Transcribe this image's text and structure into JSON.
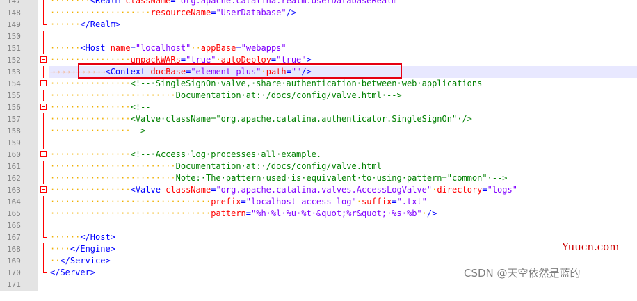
{
  "lines": [
    {
      "n": "147",
      "indent": "········",
      "tokens": [
        [
          "tag",
          "<Realm "
        ],
        [
          "attr",
          "className"
        ],
        [
          "tag",
          "="
        ],
        [
          "val",
          "\"org.apache.catalina.realm.UserDatabaseRealm\""
        ]
      ],
      "fold": "line"
    },
    {
      "n": "148",
      "indent": "····················",
      "tokens": [
        [
          "attr",
          "resourceName"
        ],
        [
          "tag",
          "="
        ],
        [
          "val",
          "\"UserDatabase\""
        ],
        [
          "tag",
          "/>"
        ]
      ],
      "fold": "line"
    },
    {
      "n": "149",
      "indent": "······",
      "tokens": [
        [
          "tag",
          "</Realm>"
        ]
      ],
      "fold": "end"
    },
    {
      "n": "150",
      "indent": "",
      "tokens": [],
      "fold": "line"
    },
    {
      "n": "151",
      "indent": "······",
      "tokens": [
        [
          "tag",
          "<Host "
        ],
        [
          "attr",
          "name"
        ],
        [
          "tag",
          "="
        ],
        [
          "val",
          "\"localhost\""
        ],
        [
          "ws",
          "··"
        ],
        [
          "attr",
          "appBase"
        ],
        [
          "tag",
          "="
        ],
        [
          "val",
          "\"webapps\""
        ]
      ],
      "fold": "line"
    },
    {
      "n": "152",
      "indent": "················",
      "tokens": [
        [
          "attr",
          "unpackWARs"
        ],
        [
          "tag",
          "="
        ],
        [
          "val",
          "\"true\""
        ],
        [
          "ws",
          "·"
        ],
        [
          "attr",
          "autoDeploy"
        ],
        [
          "tag",
          "="
        ],
        [
          "val",
          "\"true\""
        ],
        [
          "tag",
          ">"
        ]
      ],
      "fold": "box"
    },
    {
      "n": "153",
      "indent": "→→→→→→→→→→→",
      "tokens": [
        [
          "tag",
          "<Context "
        ],
        [
          "attr",
          "docBase"
        ],
        [
          "tag",
          "="
        ],
        [
          "val",
          "\"element-plus\""
        ],
        [
          "ws",
          "·"
        ],
        [
          "attr",
          "path"
        ],
        [
          "tag",
          "="
        ],
        [
          "val",
          "\"\""
        ],
        [
          "tag",
          "/>"
        ]
      ],
      "fold": "line",
      "current": true
    },
    {
      "n": "154",
      "indent": "················",
      "tokens": [
        [
          "cmt",
          "<!--·SingleSignOn·valve,·share·authentication·between·web·applications"
        ]
      ],
      "fold": "box"
    },
    {
      "n": "155",
      "indent": "·························",
      "tokens": [
        [
          "cmt",
          "Documentation·at:·/docs/config/valve.html·-->"
        ]
      ],
      "fold": "line"
    },
    {
      "n": "156",
      "indent": "················",
      "tokens": [
        [
          "cmt",
          "<!--"
        ]
      ],
      "fold": "box"
    },
    {
      "n": "157",
      "indent": "················",
      "tokens": [
        [
          "cmt",
          "<Valve·className=\"org.apache.catalina.authenticator.SingleSignOn\"·/>"
        ]
      ],
      "fold": "line"
    },
    {
      "n": "158",
      "indent": "················",
      "tokens": [
        [
          "cmt",
          "-->"
        ]
      ],
      "fold": "line"
    },
    {
      "n": "159",
      "indent": "",
      "tokens": [],
      "fold": "line"
    },
    {
      "n": "160",
      "indent": "················",
      "tokens": [
        [
          "cmt",
          "<!--·Access·log·processes·all·example."
        ]
      ],
      "fold": "box"
    },
    {
      "n": "161",
      "indent": "·························",
      "tokens": [
        [
          "cmt",
          "Documentation·at:·/docs/config/valve.html"
        ]
      ],
      "fold": "line"
    },
    {
      "n": "162",
      "indent": "·························",
      "tokens": [
        [
          "cmt",
          "Note:·The·pattern·used·is·equivalent·to·using·pattern=\"common\"·-->"
        ]
      ],
      "fold": "line"
    },
    {
      "n": "163",
      "indent": "················",
      "tokens": [
        [
          "tag",
          "<Valve "
        ],
        [
          "attr",
          "className"
        ],
        [
          "tag",
          "="
        ],
        [
          "val",
          "\"org.apache.catalina.valves.AccessLogValve\""
        ],
        [
          "ws",
          "·"
        ],
        [
          "attr",
          "directory"
        ],
        [
          "tag",
          "="
        ],
        [
          "val",
          "\"logs\""
        ]
      ],
      "fold": "box"
    },
    {
      "n": "164",
      "indent": "································",
      "tokens": [
        [
          "attr",
          "prefix"
        ],
        [
          "tag",
          "="
        ],
        [
          "val",
          "\"localhost_access_log\""
        ],
        [
          "ws",
          "·"
        ],
        [
          "attr",
          "suffix"
        ],
        [
          "tag",
          "="
        ],
        [
          "val",
          "\".txt\""
        ]
      ],
      "fold": "line"
    },
    {
      "n": "165",
      "indent": "································",
      "tokens": [
        [
          "attr",
          "pattern"
        ],
        [
          "tag",
          "="
        ],
        [
          "val",
          "\"%h·%l·%u·%t·&quot;%r&quot;·%s·%b\""
        ],
        [
          "ws",
          "·"
        ],
        [
          "tag",
          "/>"
        ]
      ],
      "fold": "line"
    },
    {
      "n": "166",
      "indent": "",
      "tokens": [],
      "fold": "line"
    },
    {
      "n": "167",
      "indent": "······",
      "tokens": [
        [
          "tag",
          "</Host>"
        ]
      ],
      "fold": "end"
    },
    {
      "n": "168",
      "indent": "····",
      "tokens": [
        [
          "tag",
          "</Engine>"
        ]
      ],
      "fold": "line"
    },
    {
      "n": "169",
      "indent": "··",
      "tokens": [
        [
          "tag",
          "</Service>"
        ]
      ],
      "fold": "line"
    },
    {
      "n": "170",
      "indent": "",
      "tokens": [
        [
          "tag",
          "</Server>"
        ]
      ],
      "fold": "end"
    },
    {
      "n": "171",
      "indent": "",
      "tokens": [],
      "fold": "none"
    }
  ],
  "watermarks": {
    "site": "Yuucn.com",
    "csdn": "CSDN @天空依然是蓝的"
  },
  "colors": {
    "tag": "#0000ff",
    "attribute": "#ff0000",
    "value": "#8000ff",
    "comment": "#008000",
    "highlight_box": "#e60012"
  }
}
